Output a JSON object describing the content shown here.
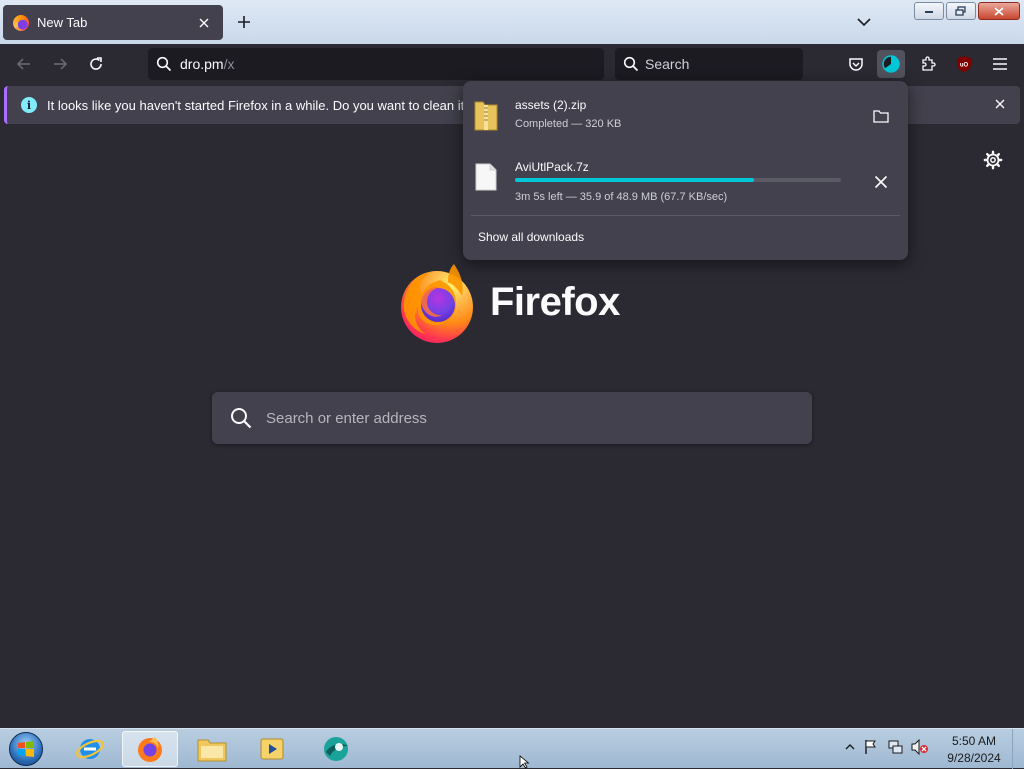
{
  "tab": {
    "title": "New Tab"
  },
  "urlbar": {
    "host": "dro.pm",
    "path": "/x"
  },
  "searchbar": {
    "placeholder": "Search"
  },
  "notification": {
    "text": "It looks like you haven't started Firefox in a while. Do you want to clean it up for"
  },
  "content": {
    "wordmark": "Firefox",
    "search_placeholder": "Search or enter address"
  },
  "downloads": {
    "items": [
      {
        "name": "assets (2).zip",
        "status": "Completed — 320 KB",
        "icon": "zip-folder-icon",
        "action": "show-in-folder"
      },
      {
        "name": "AviUtlPack.7z",
        "status": "3m 5s left — 35.9 of 48.9 MB (67.7 KB/sec)",
        "icon": "file-icon",
        "action": "cancel",
        "progress": 0.734
      }
    ],
    "show_all": "Show all downloads"
  },
  "taskbar": {
    "apps": [
      "start-orb",
      "internet-explorer",
      "firefox",
      "file-explorer",
      "media-player",
      "browser-app"
    ],
    "clock_time": "5:50 AM",
    "clock_date": "9/28/2024"
  },
  "colors": {
    "accent": "#00c8d7",
    "bg": "#2b2a33",
    "panel": "#42414d",
    "info": "#80ebff"
  }
}
